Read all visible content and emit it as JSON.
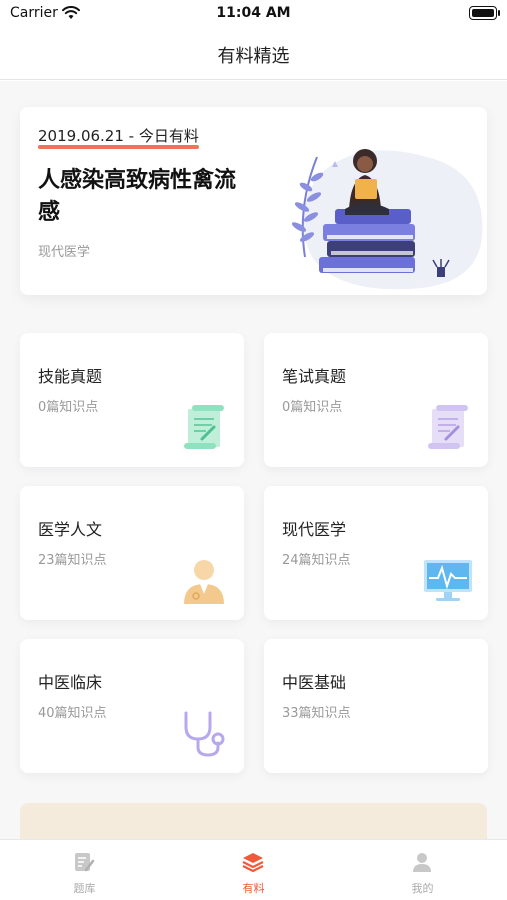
{
  "status_bar": {
    "carrier": "Carrier",
    "time": "11:04 AM"
  },
  "nav": {
    "title": "有料精选"
  },
  "hero": {
    "date": "2019.06.21 - 今日有料",
    "title": "人感染高致病性禽流感",
    "tag": "现代医学"
  },
  "categories": [
    {
      "title": "技能真题",
      "count": "0篇知识点",
      "icon": "scroll-icon"
    },
    {
      "title": "笔试真题",
      "count": "0篇知识点",
      "icon": "scroll-icon"
    },
    {
      "title": "医学人文",
      "count": "23篇知识点",
      "icon": "doctor-icon"
    },
    {
      "title": "现代医学",
      "count": "24篇知识点",
      "icon": "monitor-icon"
    },
    {
      "title": "中医临床",
      "count": "40篇知识点",
      "icon": "stethoscope-icon"
    },
    {
      "title": "中医基础",
      "count": "33篇知识点",
      "icon": "none"
    }
  ],
  "tabs": [
    {
      "label": "题库",
      "icon": "question-bank-icon",
      "active": false
    },
    {
      "label": "有料",
      "icon": "layers-icon",
      "active": true
    },
    {
      "label": "我的",
      "icon": "user-icon",
      "active": false
    }
  ],
  "colors": {
    "accent": "#f05a3a",
    "background": "#f7f7f8"
  }
}
